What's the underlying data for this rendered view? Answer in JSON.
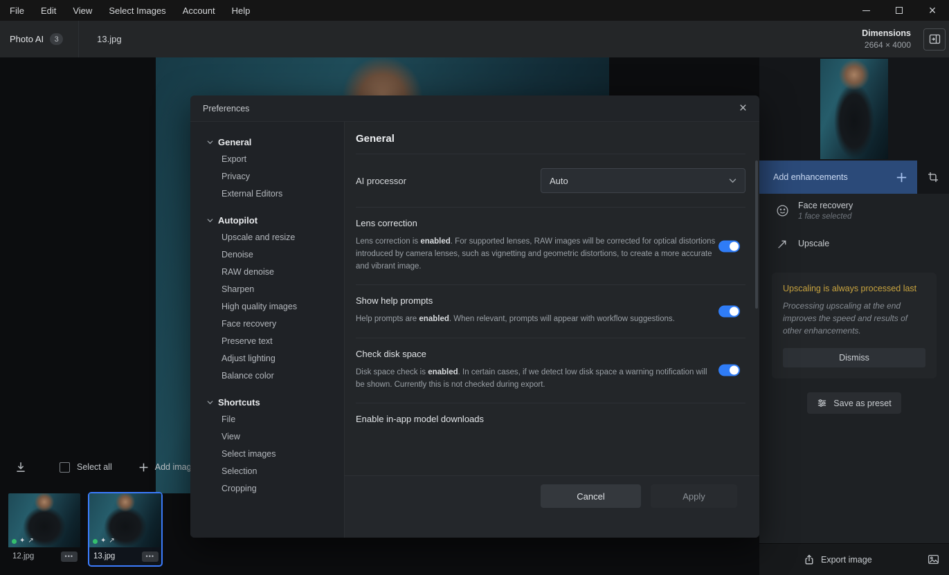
{
  "colors": {
    "accent_blue": "#3c7dff",
    "toggle_on": "#2f7cf6",
    "warning_yellow": "#c9a43f",
    "add_enhancements_bg": "#2b4a79"
  },
  "icons": {
    "close": "×",
    "dots": "•••",
    "sparkle": "✦",
    "arrow_ne": "↗"
  },
  "menu_bar": {
    "items": [
      "File",
      "Edit",
      "View",
      "Select Images",
      "Account",
      "Help"
    ]
  },
  "tab_bar": {
    "app_name": "Photo AI",
    "badge": "3",
    "file_tab": "13.jpg",
    "dimensions_label": "Dimensions",
    "dimensions_value": "2664 × 4000"
  },
  "dialog": {
    "title": "Preferences",
    "sidebar": {
      "sections": [
        {
          "label": "General",
          "items": [
            "Export",
            "Privacy",
            "External Editors"
          ]
        },
        {
          "label": "Autopilot",
          "items": [
            "Upscale and resize",
            "Denoise",
            "RAW denoise",
            "Sharpen",
            "High quality images",
            "Face recovery",
            "Preserve text",
            "Adjust lighting",
            "Balance color"
          ]
        },
        {
          "label": "Shortcuts",
          "items": [
            "File",
            "View",
            "Select images",
            "Selection",
            "Cropping"
          ]
        }
      ]
    },
    "content": {
      "heading": "General",
      "ai_processor": {
        "label": "AI processor",
        "value": "Auto"
      },
      "settings": [
        {
          "title": "Lens correction",
          "desc_prefix": "Lens correction is ",
          "desc_bold": "enabled",
          "desc_suffix": ". For supported lenses, RAW images will be corrected for optical distortions introduced by camera lenses, such as vignetting and geometric distortions, to create a more accurate and vibrant image.",
          "enabled": true
        },
        {
          "title": "Show help prompts",
          "desc_prefix": "Help prompts are ",
          "desc_bold": "enabled",
          "desc_suffix": ". When relevant, prompts will appear with workflow suggestions.",
          "enabled": true
        },
        {
          "title": "Check disk space",
          "desc_prefix": "Disk space check is ",
          "desc_bold": "enabled",
          "desc_suffix": ". In certain cases, if we detect low disk space a warning notification will be shown. Currently this is not checked during export.",
          "enabled": true
        }
      ],
      "more_setting_title": "Enable in-app model downloads",
      "cancel_label": "Cancel",
      "apply_label": "Apply"
    }
  },
  "right_panel": {
    "add_enhancements_label": "Add enhancements",
    "items": [
      {
        "label": "Face recovery",
        "sublabel": "1 face selected"
      },
      {
        "label": "Upscale",
        "sublabel": ""
      }
    ],
    "notice": {
      "title": "Upscaling is always processed last",
      "body": "Processing upscaling at the end improves the speed and results of other enhancements.",
      "dismiss_label": "Dismiss"
    },
    "save_preset_label": "Save as preset",
    "export_label": "Export image"
  },
  "bottom_toolbar": {
    "select_all_label": "Select all",
    "add_images_label": "Add images"
  },
  "filmstrip": {
    "items": [
      {
        "filename": "12.jpg",
        "selected": false
      },
      {
        "filename": "13.jpg",
        "selected": true
      }
    ]
  }
}
